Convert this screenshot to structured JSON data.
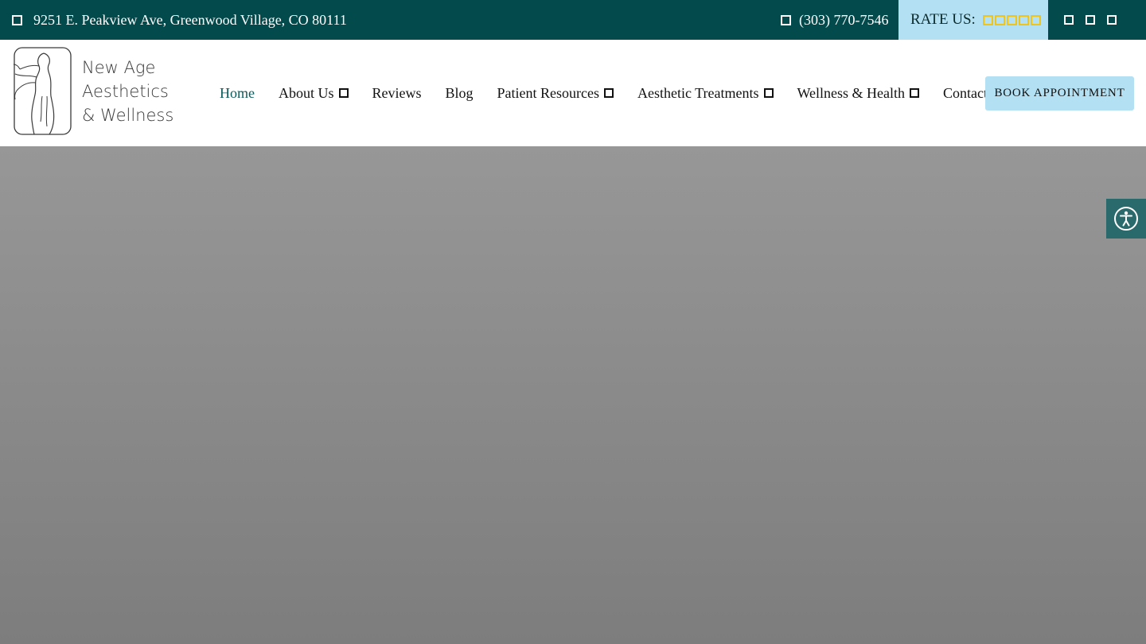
{
  "topbar": {
    "address": "9251 E. Peakview Ave, Greenwood Village, CO 80111",
    "phone": "(303) 770-7546",
    "rate_label": "RATE US:",
    "star_count": 5,
    "social_icons": [
      "social-icon-1",
      "social-icon-2",
      "social-icon-3"
    ]
  },
  "logo": {
    "lines": [
      "New Age",
      "Aesthetics",
      "& Wellness"
    ]
  },
  "nav": {
    "items": [
      {
        "label": "Home",
        "active": true,
        "dropdown": false
      },
      {
        "label": "About Us",
        "active": false,
        "dropdown": true
      },
      {
        "label": "Reviews",
        "active": false,
        "dropdown": false
      },
      {
        "label": "Blog",
        "active": false,
        "dropdown": false
      },
      {
        "label": "Patient Resources",
        "active": false,
        "dropdown": true
      },
      {
        "label": "Aesthetic Treatments",
        "active": false,
        "dropdown": true
      },
      {
        "label": "Wellness & Health",
        "active": false,
        "dropdown": true
      },
      {
        "label": "Contact",
        "active": false,
        "dropdown": false
      }
    ],
    "book_button": "BOOK APPOINTMENT"
  },
  "colors": {
    "topbar_bg": "#024a4c",
    "accent_light_blue": "#b3e0f2",
    "star_color": "#f0c419",
    "active_link": "#0a5a5c",
    "accessibility_bg": "#2b6a6c"
  },
  "accessibility": {
    "icon": "accessibility-icon"
  }
}
